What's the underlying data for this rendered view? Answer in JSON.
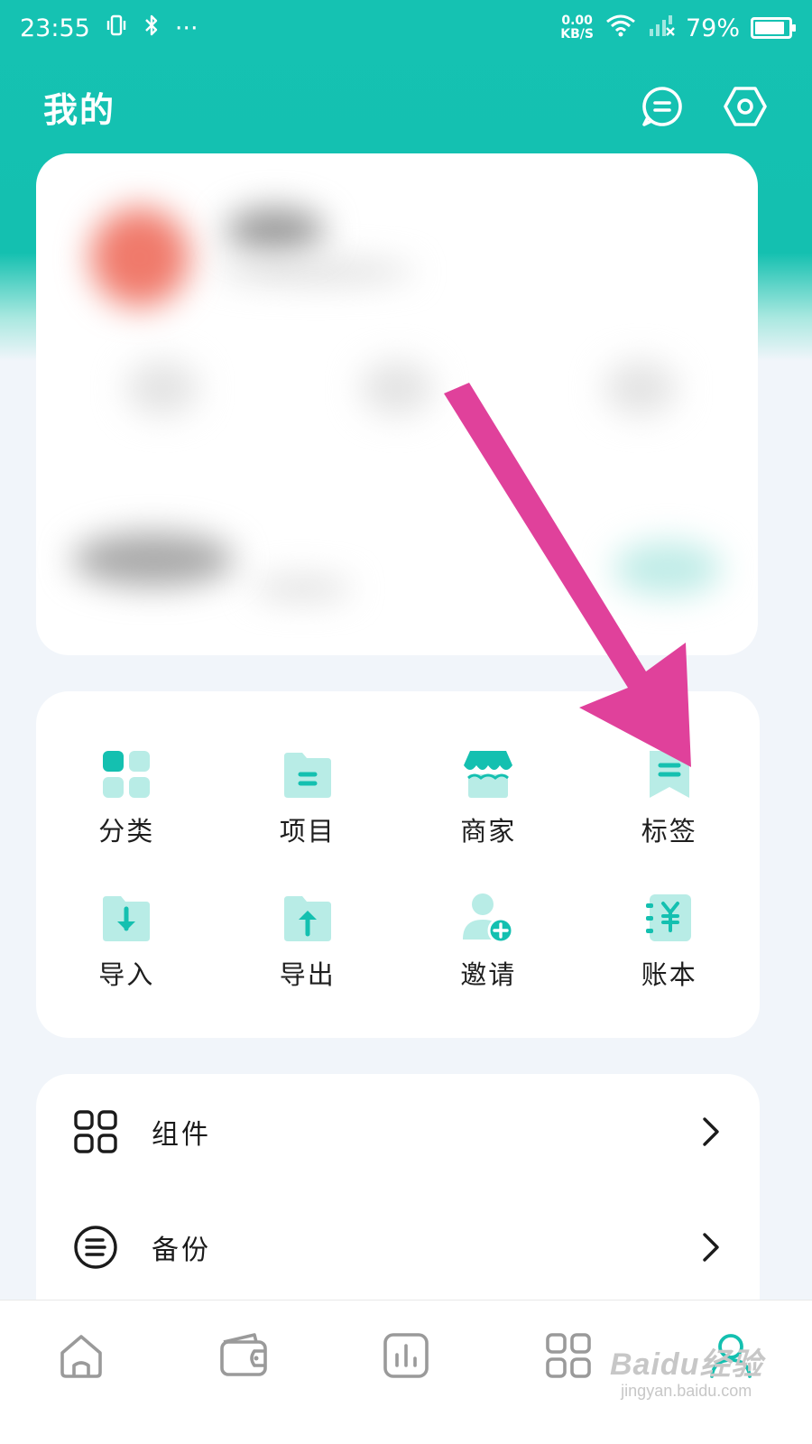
{
  "status_bar": {
    "time": "23:55",
    "more": "···",
    "net_speed_value": "0.00",
    "net_speed_unit": "KB/S",
    "battery": "79%"
  },
  "header": {
    "title": "我的",
    "message_icon": "message-icon",
    "settings_icon": "settings-hexagon-icon"
  },
  "theme": {
    "accent": "#14c0b0",
    "icon_light": "#b8ece6",
    "arrow": "#e0419b"
  },
  "grid": {
    "items": [
      {
        "label": "分类",
        "icon": "category-icon"
      },
      {
        "label": "项目",
        "icon": "project-folder-icon"
      },
      {
        "label": "商家",
        "icon": "merchant-store-icon"
      },
      {
        "label": "标签",
        "icon": "tag-bookmark-icon"
      },
      {
        "label": "导入",
        "icon": "import-folder-icon"
      },
      {
        "label": "导出",
        "icon": "export-folder-icon"
      },
      {
        "label": "邀请",
        "icon": "invite-user-icon"
      },
      {
        "label": "账本",
        "icon": "ledger-book-icon"
      }
    ]
  },
  "list": {
    "items": [
      {
        "label": "组件",
        "icon": "widget-grid-icon"
      },
      {
        "label": "备份",
        "icon": "backup-icon"
      }
    ]
  },
  "bottom_nav": {
    "items": [
      {
        "icon": "home-icon"
      },
      {
        "icon": "wallet-icon"
      },
      {
        "icon": "chart-icon"
      },
      {
        "icon": "apps-grid-icon"
      },
      {
        "icon": "profile-icon",
        "active": true
      }
    ]
  },
  "watermark": {
    "brand": "Baidu经验",
    "url": "jingyan.baidu.com"
  }
}
